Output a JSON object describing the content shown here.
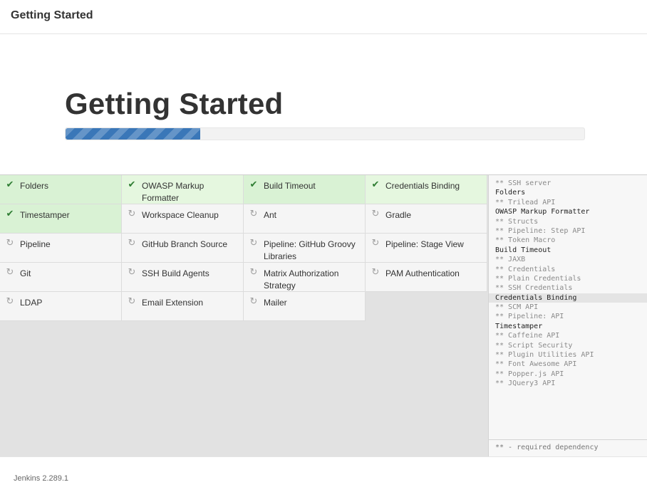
{
  "header": {
    "title": "Getting Started"
  },
  "main": {
    "title": "Getting Started",
    "progress_fraction": 0.26
  },
  "plugins": {
    "folders": {
      "label": "Folders",
      "status": "done"
    },
    "owasp": {
      "label": "OWASP Markup Formatter",
      "status": "done"
    },
    "build_timeout": {
      "label": "Build Timeout",
      "status": "done"
    },
    "credentials_binding": {
      "label": "Credentials Binding",
      "status": "done"
    },
    "timestamper": {
      "label": "Timestamper",
      "status": "done"
    },
    "workspace_cleanup": {
      "label": "Workspace Cleanup",
      "status": "pending"
    },
    "ant": {
      "label": "Ant",
      "status": "pending"
    },
    "gradle": {
      "label": "Gradle",
      "status": "pending"
    },
    "pipeline": {
      "label": "Pipeline",
      "status": "pending"
    },
    "github_branch_source": {
      "label": "GitHub Branch Source",
      "status": "pending"
    },
    "pipeline_github_groovy": {
      "label": "Pipeline: GitHub Groovy Libraries",
      "status": "pending"
    },
    "pipeline_stage_view": {
      "label": "Pipeline: Stage View",
      "status": "pending"
    },
    "git": {
      "label": "Git",
      "status": "pending"
    },
    "ssh_build_agents": {
      "label": "SSH Build Agents",
      "status": "pending"
    },
    "matrix_auth": {
      "label": "Matrix Authorization Strategy",
      "status": "pending"
    },
    "pam_auth": {
      "label": "PAM Authentication",
      "status": "pending"
    },
    "ldap": {
      "label": "LDAP",
      "status": "pending"
    },
    "email_extension": {
      "label": "Email Extension",
      "status": "pending"
    },
    "mailer": {
      "label": "Mailer",
      "status": "pending"
    }
  },
  "log": {
    "lines": [
      "** SSH server",
      "Folders",
      "** Trilead API",
      "OWASP Markup Formatter",
      "** Structs",
      "** Pipeline: Step API",
      "** Token Macro",
      "Build Timeout",
      "** JAXB",
      "** Credentials",
      "** Plain Credentials",
      "** SSH Credentials",
      "Credentials Binding",
      "** SCM API",
      "** Pipeline: API",
      "Timestamper",
      "** Caffeine API",
      "** Script Security",
      "** Plugin Utilities API",
      "** Font Awesome API",
      "** Popper.js API",
      "** JQuery3 API"
    ],
    "current_line": "Credentials Binding",
    "legend": "** - required dependency"
  },
  "footer": {
    "version": "Jenkins 2.289.1"
  },
  "icons": {
    "done": "check-icon",
    "pending": "refresh-icon"
  },
  "colors": {
    "accent": "#3a77b8",
    "done_bg": "#d9f2d4",
    "check": "#2e7d32"
  }
}
